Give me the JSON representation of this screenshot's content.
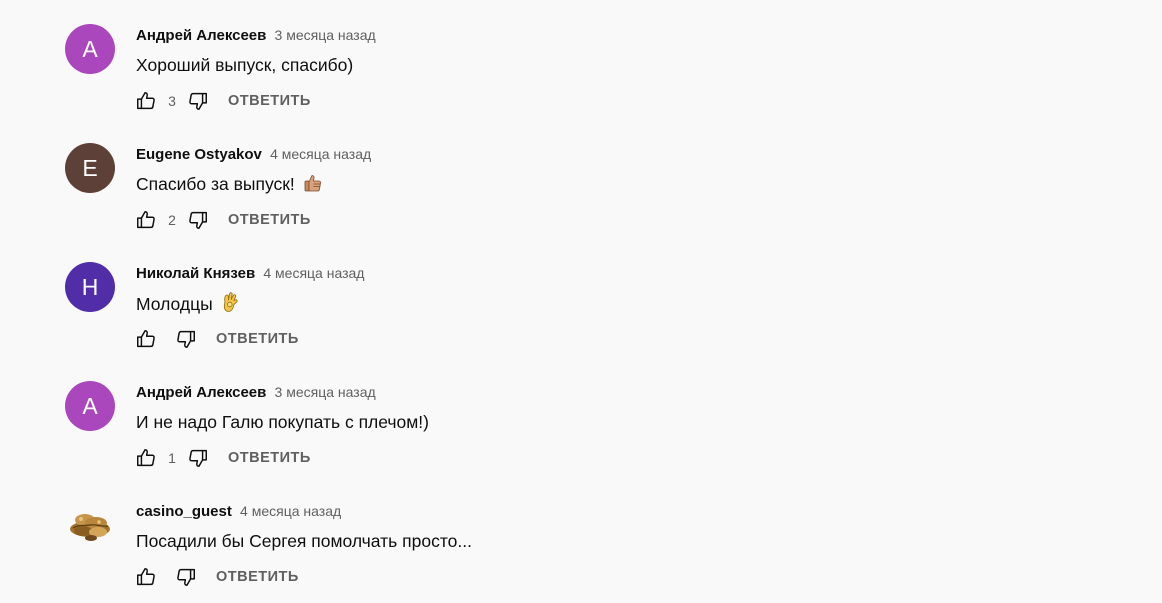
{
  "comments": [
    {
      "author": "Андрей Алексеев",
      "time": "3 месяца назад",
      "text": "Хороший выпуск, спасибо)",
      "avatar_letter": "А",
      "avatar_color": "#ab47bc",
      "likes": "3",
      "reply_label": "ОТВЕТИТЬ",
      "emoji": ""
    },
    {
      "author": "Eugene Ostyakov",
      "time": "4 месяца назад",
      "text": "Спасибо за выпуск!",
      "avatar_letter": "E",
      "avatar_color": "#5d4037",
      "likes": "2",
      "reply_label": "ОТВЕТИТЬ",
      "emoji": "thumbs-up-emoji"
    },
    {
      "author": "Николай Князев",
      "time": "4 месяца назад",
      "text": "Молодцы",
      "avatar_letter": "Н",
      "avatar_color": "#512da8",
      "likes": "",
      "reply_label": "ОТВЕТИТЬ",
      "emoji": "ok-hand-emoji"
    },
    {
      "author": "Андрей Алексеев",
      "time": "3 месяца назад",
      "text": "И не надо Галю покупать с плечом!)",
      "avatar_letter": "А",
      "avatar_color": "#ab47bc",
      "likes": "1",
      "reply_label": "ОТВЕТИТЬ",
      "emoji": ""
    },
    {
      "author": "casino_guest",
      "time": "4 месяца назад",
      "text": "Посадили бы Сергея помолчать просто...",
      "avatar_letter": "",
      "avatar_color": "",
      "likes": "",
      "reply_label": "ОТВЕТИТЬ",
      "emoji": ""
    }
  ],
  "icons": {
    "like": "thumb-up-outline-icon",
    "dislike": "thumb-down-outline-icon"
  },
  "colors": {
    "background": "#f9f9f9",
    "secondary_text": "#606060",
    "primary_text": "#0f0f0f"
  }
}
